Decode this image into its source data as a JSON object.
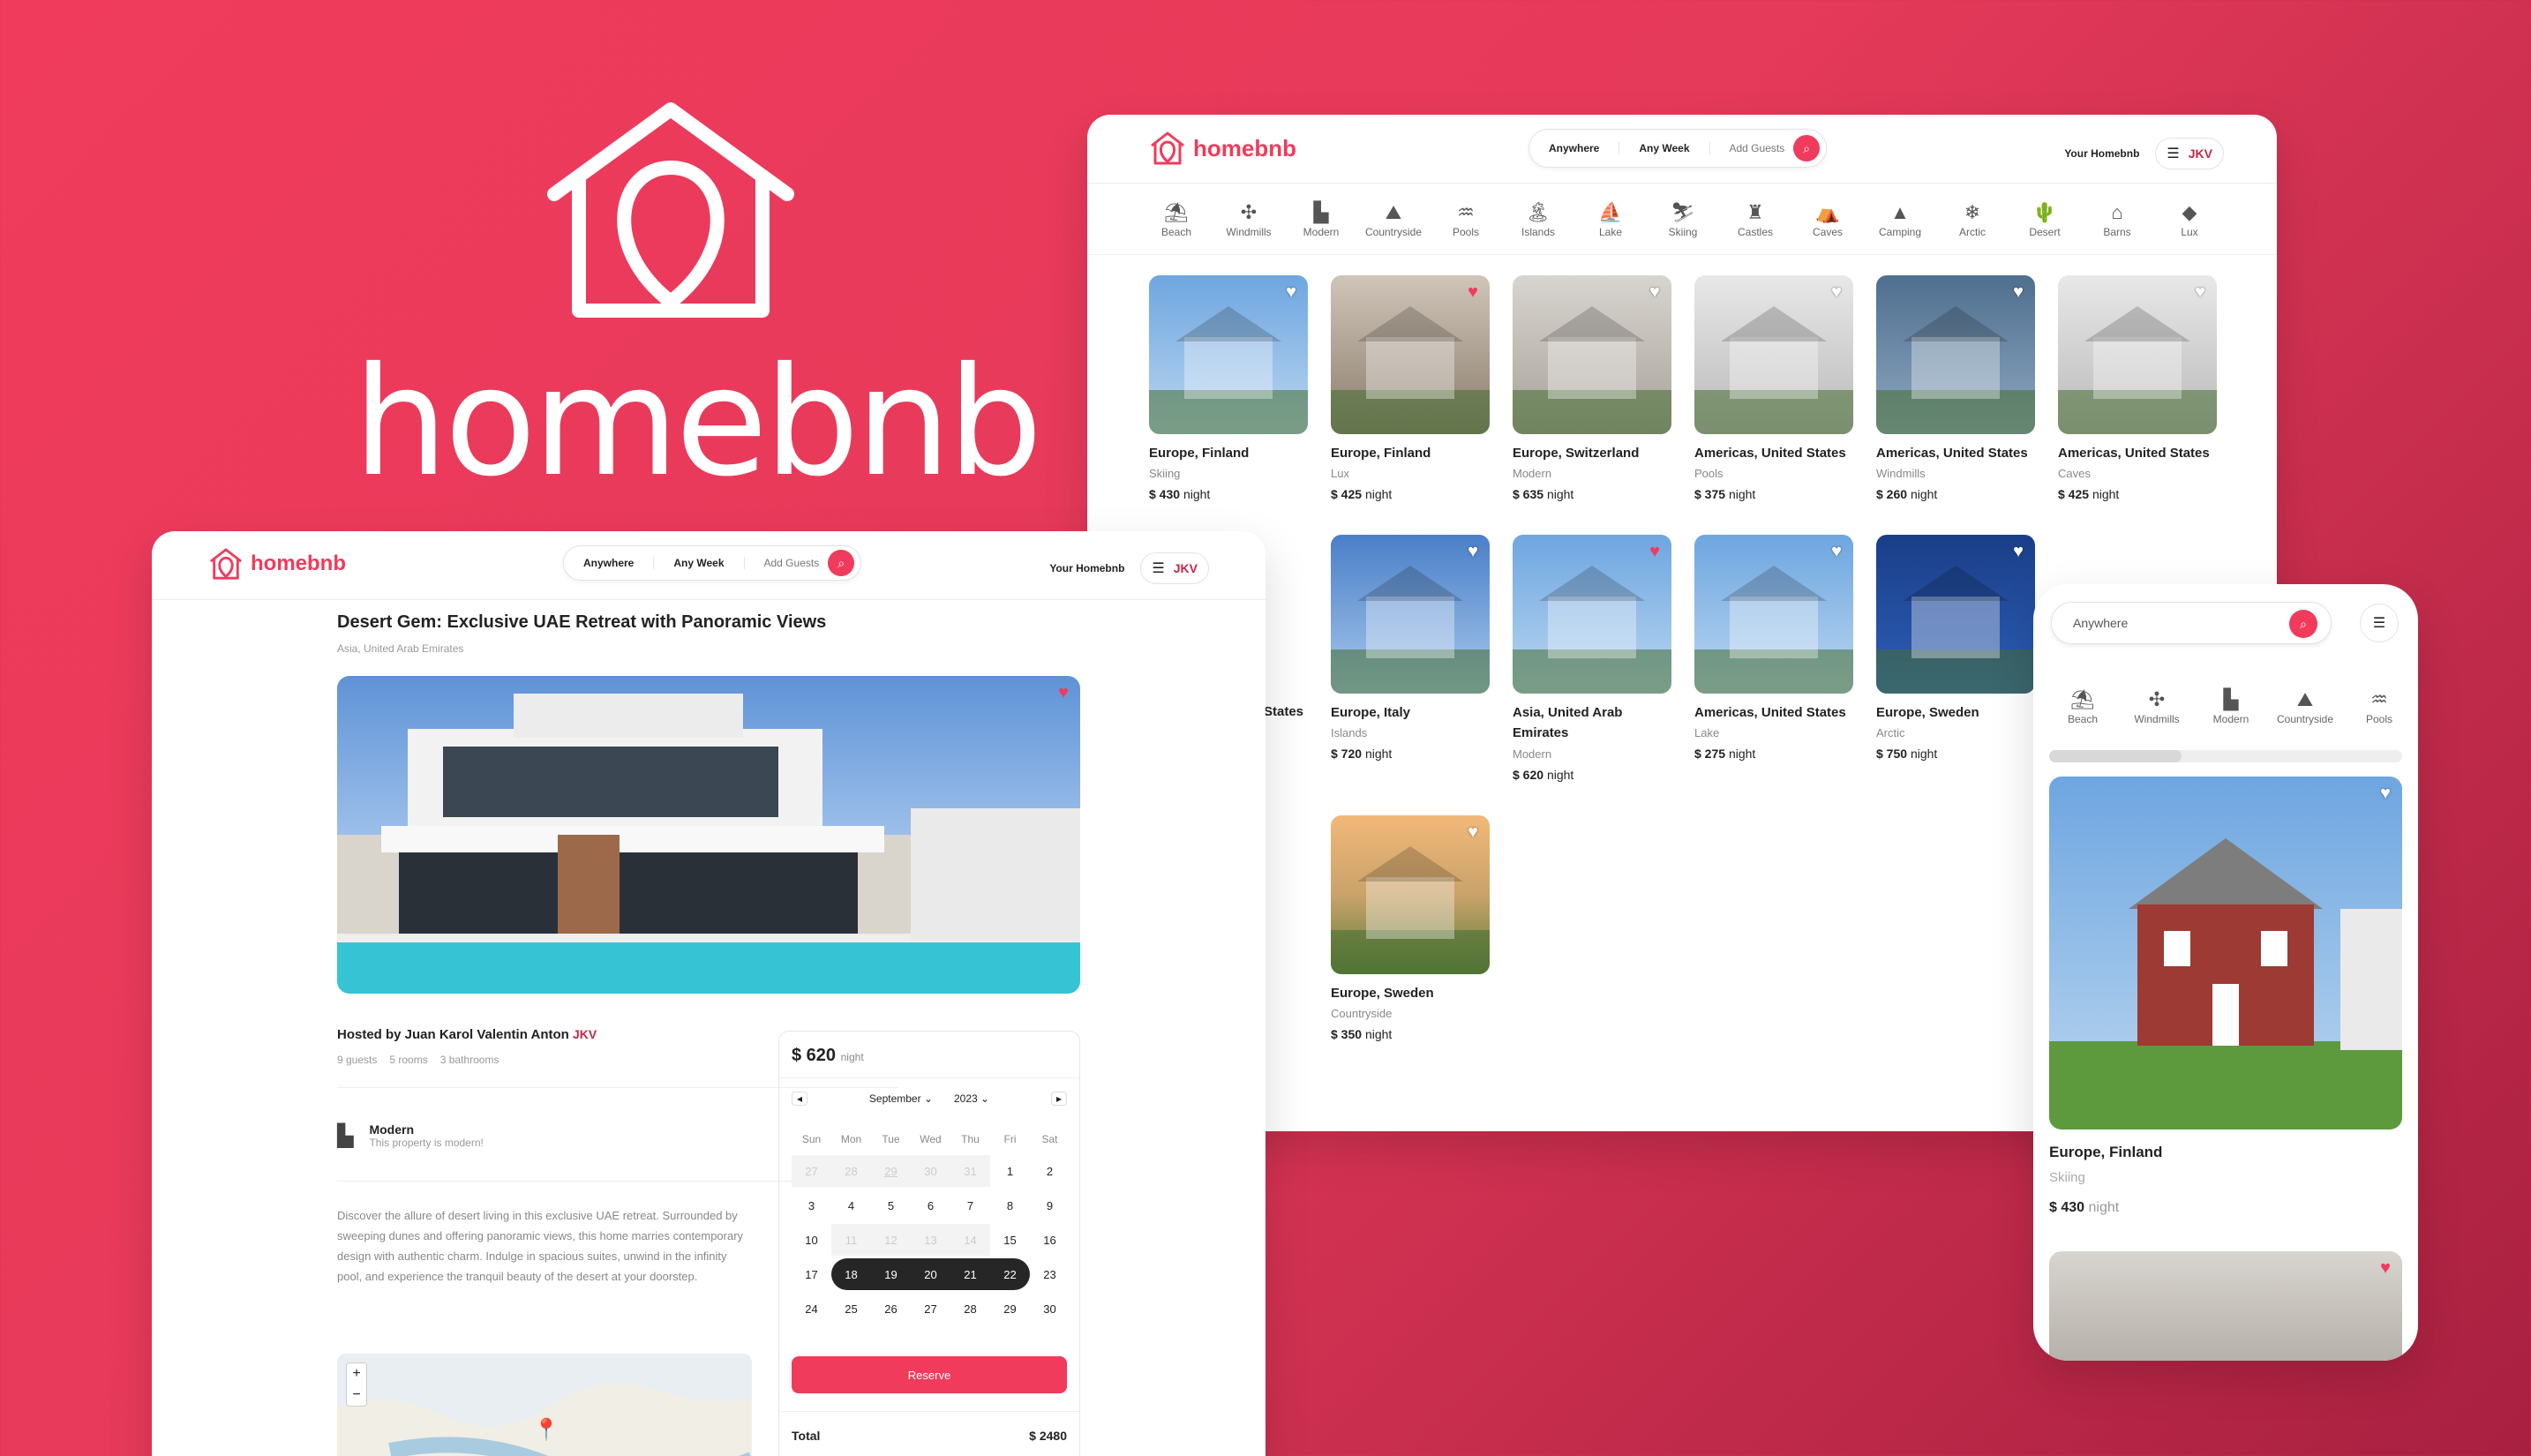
{
  "brand": {
    "name": "homebnb",
    "accent": "#f03b5c"
  },
  "nav": {
    "anywhere": "Anywhere",
    "any_week": "Any Week",
    "add_guests": "Add Guests",
    "your_homebnb": "Your Homebnb",
    "avatar": "JKV"
  },
  "categories": [
    {
      "label": "Beach",
      "icon": "beach-icon"
    },
    {
      "label": "Windmills",
      "icon": "windmill-icon"
    },
    {
      "label": "Modern",
      "icon": "modern-icon"
    },
    {
      "label": "Countryside",
      "icon": "countryside-icon"
    },
    {
      "label": "Pools",
      "icon": "pool-icon"
    },
    {
      "label": "Islands",
      "icon": "island-icon"
    },
    {
      "label": "Lake",
      "icon": "lake-icon"
    },
    {
      "label": "Skiing",
      "icon": "skiing-icon"
    },
    {
      "label": "Castles",
      "icon": "castle-icon"
    },
    {
      "label": "Caves",
      "icon": "cave-icon"
    },
    {
      "label": "Camping",
      "icon": "camping-icon"
    },
    {
      "label": "Arctic",
      "icon": "snowflake-icon"
    },
    {
      "label": "Desert",
      "icon": "cactus-icon"
    },
    {
      "label": "Barns",
      "icon": "barn-icon"
    },
    {
      "label": "Lux",
      "icon": "diamond-icon"
    }
  ],
  "listings_row1": [
    {
      "location": "Europe, Finland",
      "category": "Skiing",
      "price": "$ 430",
      "unit": "night",
      "fav": false
    },
    {
      "location": "Europe, Finland",
      "category": "Lux",
      "price": "$ 425",
      "unit": "night",
      "fav": true
    },
    {
      "location": "Europe, Switzerland",
      "category": "Modern",
      "price": "$ 635",
      "unit": "night",
      "fav": false
    },
    {
      "location": "Americas, United States",
      "category": "Pools",
      "price": "$ 375",
      "unit": "night",
      "fav": false
    },
    {
      "location": "Americas, United States",
      "category": "Windmills",
      "price": "$ 260",
      "unit": "night",
      "fav": false
    },
    {
      "location": "Americas, United States",
      "category": "Caves",
      "price": "$ 425",
      "unit": "night",
      "fav": false
    }
  ],
  "listings_row2": [
    {
      "location": "Europe, Italy",
      "category": "Islands",
      "price": "$ 720",
      "unit": "night",
      "fav": false
    },
    {
      "location": "Asia, United Arab Emirates",
      "category": "Modern",
      "price": "$ 620",
      "unit": "night",
      "fav": true
    },
    {
      "location": "Americas, United States",
      "category": "Lake",
      "price": "$ 275",
      "unit": "night",
      "fav": false
    },
    {
      "location": "Europe, Sweden",
      "category": "Arctic",
      "price": "$ 750",
      "unit": "night",
      "fav": false
    }
  ],
  "listing_row2_partial_left": "States",
  "listings_row3": [
    {
      "location": "Europe, Sweden",
      "category": "Countryside",
      "price": "$ 350",
      "unit": "night",
      "fav": false
    }
  ],
  "detail": {
    "title": "Desert Gem: Exclusive UAE Retreat with Panoramic Views",
    "location": "Asia, United Arab Emirates",
    "host": "Hosted by Juan Karol Valentin Anton",
    "guests": "9 guests",
    "rooms": "5 rooms",
    "bathrooms": "3 bathrooms",
    "category_title": "Modern",
    "category_desc": "This property is modern!",
    "description": "Discover the allure of desert living in this exclusive UAE retreat. Surrounded by sweeping dunes and offering panoramic views, this home marries contemporary design with authentic charm. Indulge in spacious suites, unwind in the infinity pool, and experience the tranquil beauty of the desert at your doorstep.",
    "price": "$ 620",
    "unit": "night",
    "month": "September",
    "year": "2023",
    "weekdays": [
      "Sun",
      "Mon",
      "Tue",
      "Wed",
      "Thu",
      "Fri",
      "Sat"
    ],
    "reserve": "Reserve",
    "total_label": "Total",
    "total_value": "$ 2480",
    "map_zoom_in": "+",
    "map_zoom_out": "−"
  },
  "mobile": {
    "search": "Anywhere",
    "listing": {
      "location": "Europe, Finland",
      "category": "Skiing",
      "price": "$ 430",
      "unit": "night"
    }
  }
}
